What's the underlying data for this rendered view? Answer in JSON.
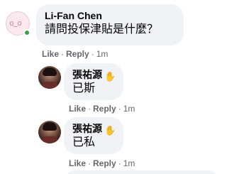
{
  "comments": [
    {
      "author": "Li-Fan Chen",
      "text": "請問投保津貼是什麼？",
      "avatar_text": "o‿o",
      "online": true,
      "actions": {
        "like": "Like",
        "reply": "Reply",
        "time": "1m"
      }
    },
    {
      "author": "張祐源",
      "badge_icon": "top-fan-hand-icon",
      "badge_glyph": "✋",
      "text": "已斯",
      "actions": {
        "like": "Like",
        "reply": "Reply",
        "time": "1m"
      }
    },
    {
      "author": "張祐源",
      "badge_icon": "top-fan-hand-icon",
      "badge_glyph": "✋",
      "text": "已私",
      "actions": {
        "like": "Like",
        "reply": "Reply",
        "time": "1m"
      }
    }
  ],
  "separators": {
    "dot": "·"
  }
}
